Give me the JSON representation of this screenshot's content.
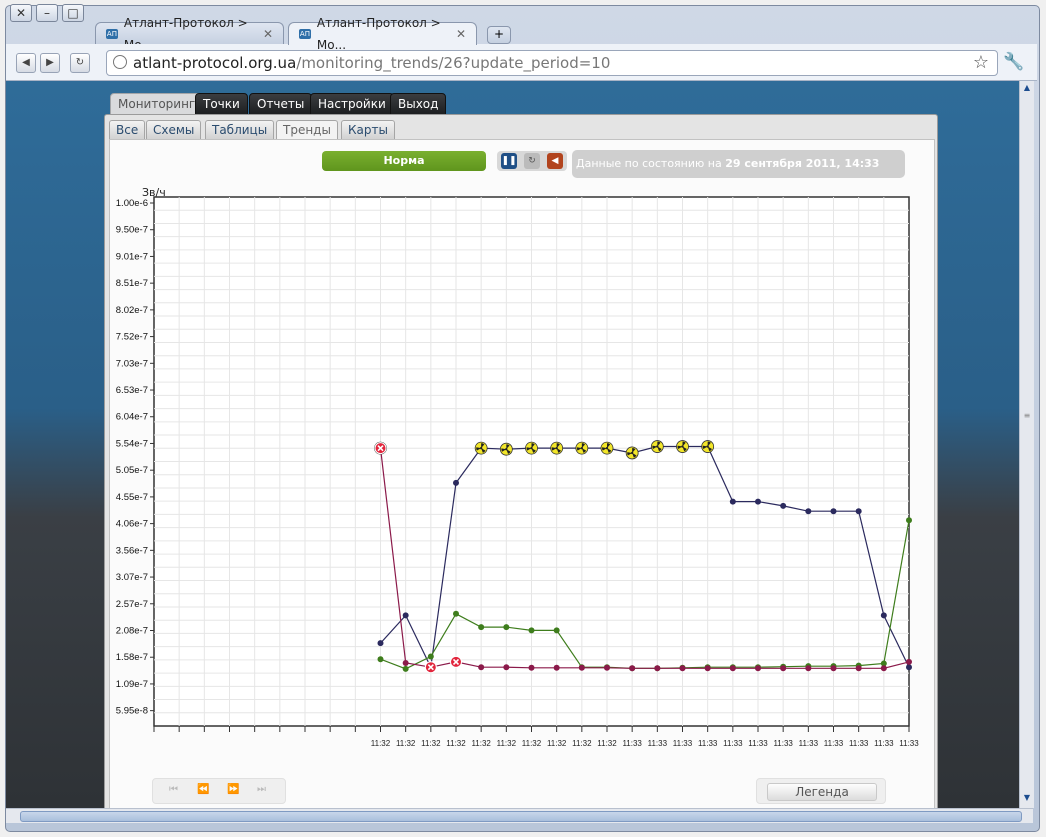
{
  "window": {
    "tabs": [
      {
        "label": "Атлант-Протокол > Мо...",
        "favicon": "АП"
      },
      {
        "label": "Атлант-Протокол > Мо...",
        "favicon": "АП"
      }
    ],
    "address": {
      "host": "atlant-protocol.org.ua",
      "path": "/monitoring_trends/26?update_period=10"
    }
  },
  "app": {
    "main_tabs": [
      "Мониторинг",
      "Точки",
      "Отчеты",
      "Настройки",
      "Выход"
    ],
    "sub_tabs": [
      "Все",
      "Схемы",
      "Таблицы",
      "Тренды",
      "Карты"
    ],
    "status": {
      "label": "Норма",
      "color": "#6aa324"
    },
    "info": {
      "prefix": "Данные по состоянию на ",
      "datetime": "29 сентября 2011, 14:33"
    },
    "legend_label": "Легенда"
  },
  "chart_data": {
    "type": "line",
    "ylabel": "Зв/ч",
    "y_ticks": [
      "1.00e-6",
      "9.50e-7",
      "9.01e-7",
      "8.51e-7",
      "8.02e-7",
      "7.52e-7",
      "7.03e-7",
      "6.53e-7",
      "6.04e-7",
      "5.54e-7",
      "5.05e-7",
      "4.55e-7",
      "4.06e-7",
      "3.56e-7",
      "3.07e-7",
      "2.57e-7",
      "2.08e-7",
      "1.58e-7",
      "1.09e-7",
      "5.95e-8"
    ],
    "x": [
      "11:32",
      "11:32",
      "11:32",
      "11:32",
      "11:32",
      "11:32",
      "11:32",
      "11:32",
      "11:32",
      "11:32",
      "11:33",
      "11:33",
      "11:33",
      "11:33",
      "11:33",
      "11:33",
      "11:33",
      "11:33",
      "11:33",
      "11:33",
      "11:33",
      "11:33"
    ],
    "ylim": [
      1e-08,
      1e-06
    ],
    "grid": true,
    "series": [
      {
        "color": "#2b2a5e",
        "values": [
          1.65e-07,
          2.17e-07,
          1.2e-07,
          4.65e-07,
          5.3e-07,
          5.28e-07,
          5.3e-07,
          5.3e-07,
          5.3e-07,
          5.3e-07,
          5.21e-07,
          5.33e-07,
          5.33e-07,
          5.33e-07,
          4.3e-07,
          4.3e-07,
          4.22e-07,
          4.12e-07,
          4.12e-07,
          4.12e-07,
          2.17e-07,
          1.2e-07
        ],
        "alarm_markers": [
          4,
          5,
          6,
          7,
          8,
          9,
          10,
          11,
          12,
          13
        ]
      },
      {
        "color": "#3e7d1c",
        "values": [
          1.35e-07,
          1.17e-07,
          1.4e-07,
          2.2e-07,
          1.95e-07,
          1.95e-07,
          1.89e-07,
          1.89e-07,
          1.2e-07,
          1.2e-07,
          1.18e-07,
          1.18e-07,
          1.19e-07,
          1.2e-07,
          1.2e-07,
          1.2e-07,
          1.21e-07,
          1.22e-07,
          1.22e-07,
          1.23e-07,
          1.27e-07,
          3.95e-07
        ]
      },
      {
        "color": "#8b1a4a",
        "values": [
          5.3e-07,
          1.28e-07,
          1.2e-07,
          1.3e-07,
          1.2e-07,
          1.2e-07,
          1.19e-07,
          1.19e-07,
          1.19e-07,
          1.19e-07,
          1.18e-07,
          1.18e-07,
          1.18e-07,
          1.18e-07,
          1.18e-07,
          1.18e-07,
          1.18e-07,
          1.18e-07,
          1.18e-07,
          1.18e-07,
          1.18e-07,
          1.3e-07
        ],
        "alarm_markers": [
          0
        ],
        "error_markers": [
          0,
          2,
          3
        ]
      }
    ]
  }
}
